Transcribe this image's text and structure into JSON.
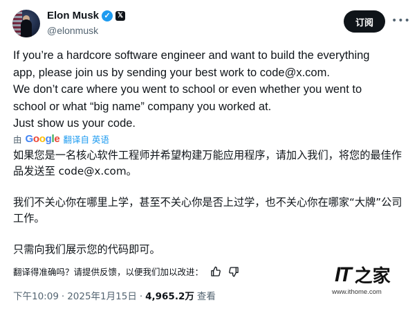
{
  "author": {
    "name": "Elon Musk",
    "handle": "@elonmusk",
    "verified_icon": "verified-badge-icon",
    "affiliation_icon": "x-logo-icon"
  },
  "header": {
    "subscribe_label": "订阅",
    "more_icon": "more-icon"
  },
  "tweet": {
    "english_lines": [
      "If you’re a hardcore software engineer and want to build the everything",
      "app, please join us by sending your best work to code@x.com.",
      "We don’t care where you went to school or even whether you went to",
      "school or what “big name” company you worked at.",
      "Just show us your code."
    ],
    "translated_by_prefix": "由",
    "translated_by_brand": "Google",
    "translate_label": "翻译自 英语",
    "chinese_paragraphs": [
      "如果您是一名核心软件工程师并希望构建万能应用程序，请加入我们，将您的最佳作品发送至 code@x.com。",
      "我们不关心你在哪里上学，甚至不关心你是否上过学，也不关心你在哪家“大牌”公司工作。",
      "只需向我们展示您的代码即可。"
    ]
  },
  "feedback": {
    "prompt": "翻译得准确吗？请提供反馈，以便我们加以改进：",
    "thumbs_up_icon": "thumbs-up-icon",
    "thumbs_down_icon": "thumbs-down-icon"
  },
  "meta": {
    "time": "下午10:09",
    "separator1": "·",
    "date": "2025年1月15日",
    "separator2": "·",
    "views": "4,965.2万",
    "views_label": "查看"
  },
  "watermark": {
    "logo_text": "IT",
    "logo_zh": "之家",
    "url": "www.ithome.com"
  }
}
